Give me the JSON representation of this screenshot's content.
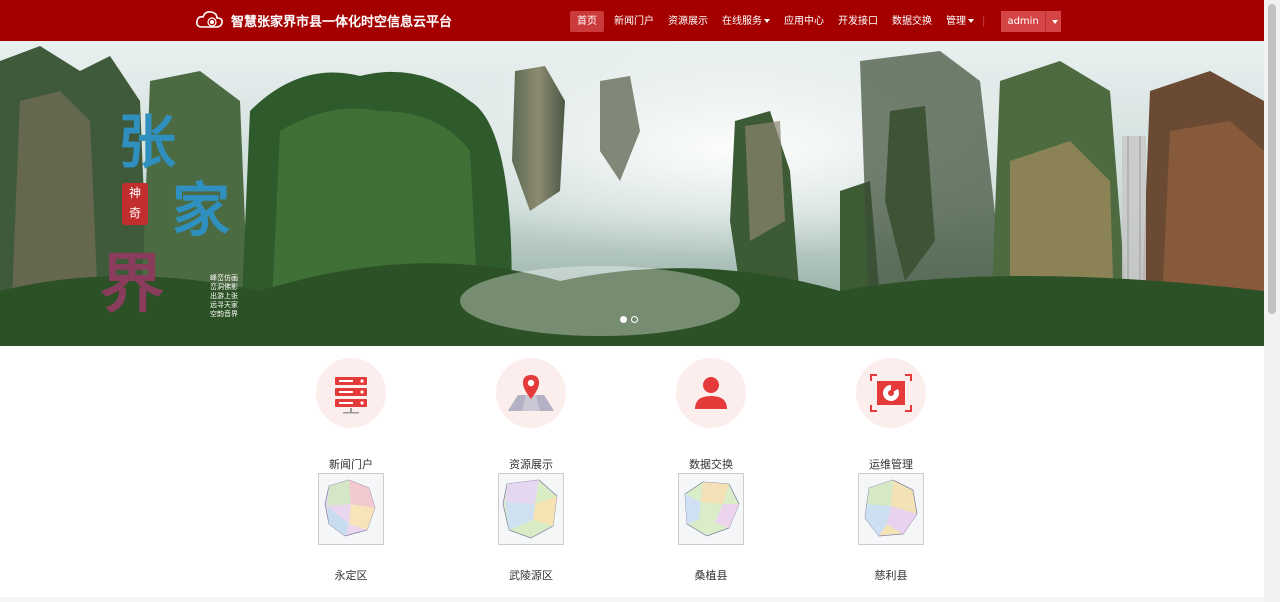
{
  "app": {
    "title": "智慧张家界市县一体化时空信息云平台",
    "logo_icon": "cloud-icon"
  },
  "nav": {
    "items": [
      {
        "label": "首页",
        "active": true,
        "dropdown": false
      },
      {
        "label": "新闻门户",
        "active": false,
        "dropdown": false
      },
      {
        "label": "资源展示",
        "active": false,
        "dropdown": false
      },
      {
        "label": "在线服务",
        "active": false,
        "dropdown": true
      },
      {
        "label": "应用中心",
        "active": false,
        "dropdown": false
      },
      {
        "label": "开发接口",
        "active": false,
        "dropdown": false
      },
      {
        "label": "数据交换",
        "active": false,
        "dropdown": false
      },
      {
        "label": "管理",
        "active": false,
        "dropdown": true
      }
    ],
    "separator": "|"
  },
  "user": {
    "name": "admin"
  },
  "hero": {
    "calligraphy": [
      "张",
      "家",
      "界"
    ],
    "seal": [
      "神",
      "奇"
    ],
    "poem": [
      "峰峦仿画",
      "峦洞佛影",
      "出游上张",
      "远寻天家",
      "空韵音界"
    ],
    "slides": 2,
    "active_slide": 0
  },
  "services": [
    {
      "label": "新闻门户",
      "icon": "server-icon"
    },
    {
      "label": "资源展示",
      "icon": "map-pin-icon"
    },
    {
      "label": "数据交换",
      "icon": "user-icon"
    },
    {
      "label": "运维管理",
      "icon": "monitor-chart-icon"
    }
  ],
  "districts": [
    {
      "label": "永定区",
      "icon": "district-map-icon"
    },
    {
      "label": "武陵源区",
      "icon": "district-map-icon"
    },
    {
      "label": "桑植县",
      "icon": "district-map-icon"
    },
    {
      "label": "慈利县",
      "icon": "district-map-icon"
    }
  ],
  "colors": {
    "brand": "#a40000",
    "active_nav": "#cc3b3b",
    "icon_red": "#e43a3a",
    "icon_bg": "#fdeeee"
  }
}
